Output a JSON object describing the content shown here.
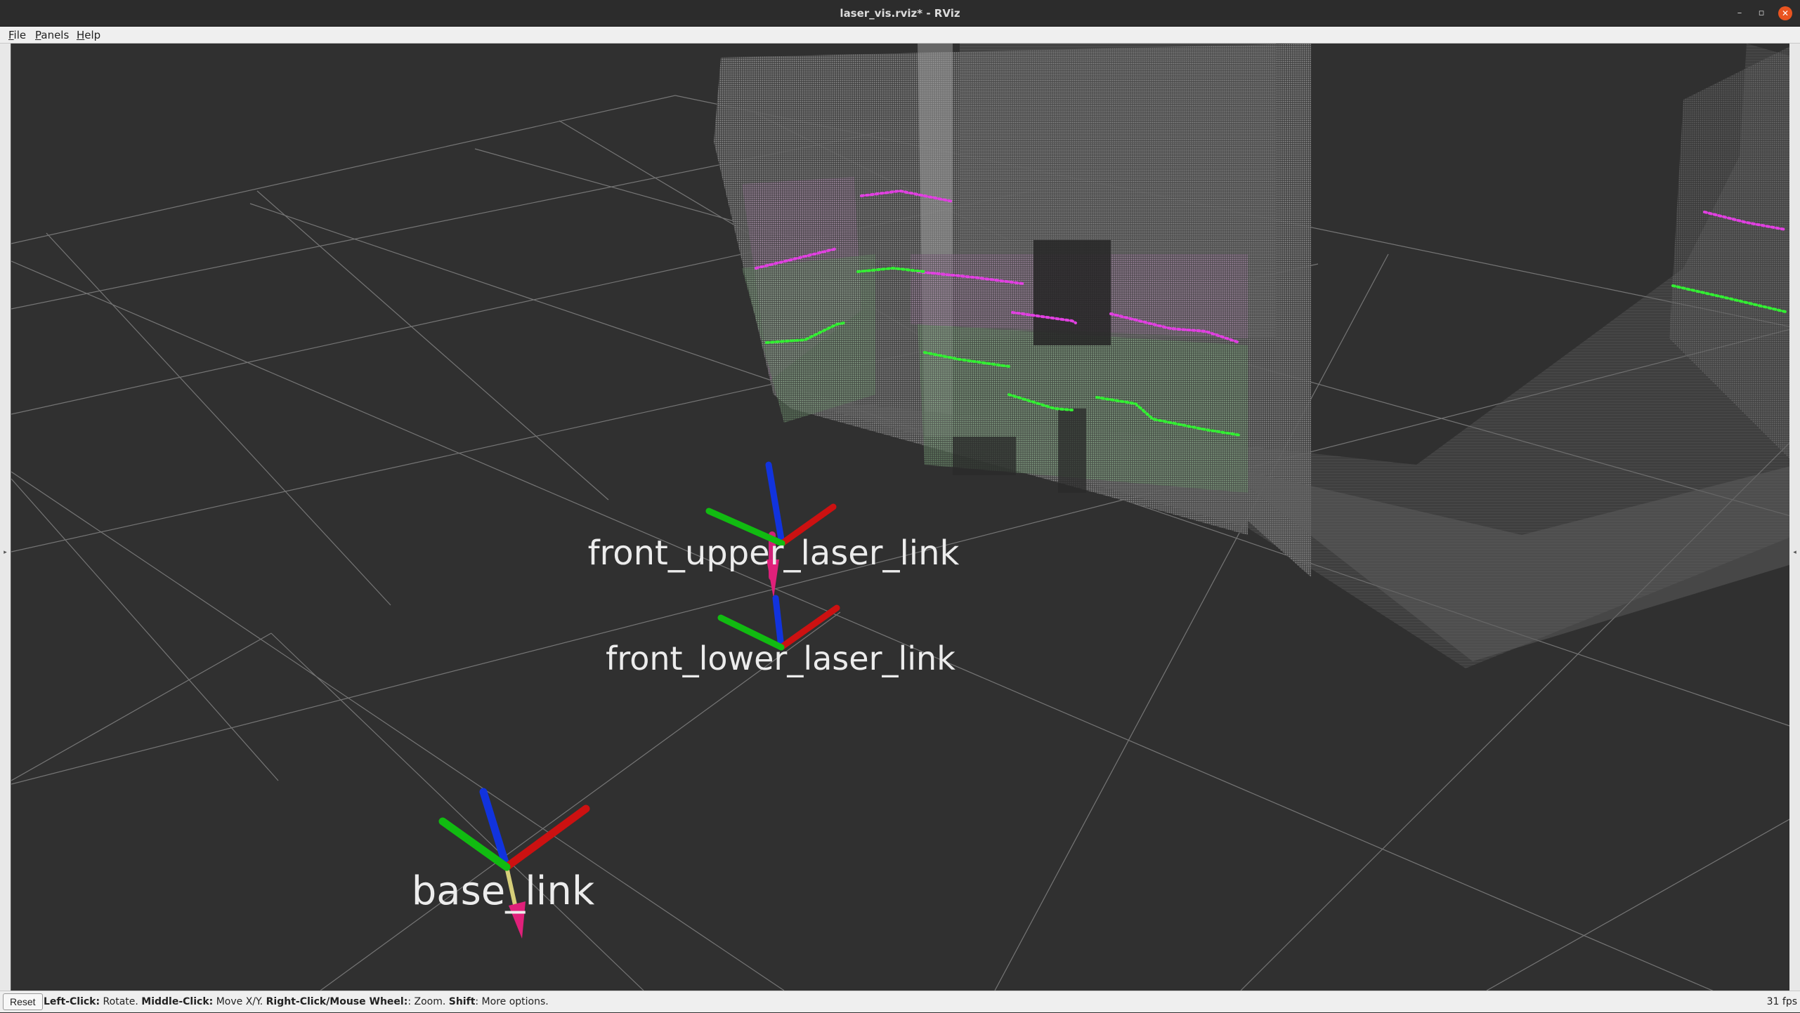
{
  "window": {
    "title": "laser_vis.rviz* - RViz",
    "minimize_icon": "minimize-icon",
    "maximize_icon": "maximize-icon",
    "close_icon": "close-icon",
    "minimize_glyph": "–",
    "maximize_glyph": "▫",
    "close_glyph": "✕"
  },
  "menu": {
    "file": {
      "mnemonic": "F",
      "rest": "ile"
    },
    "panels": {
      "mnemonic": "P",
      "rest": "anels"
    },
    "help": {
      "mnemonic": "H",
      "rest": "elp"
    }
  },
  "scene": {
    "frames": [
      {
        "name": "front_upper_laser_link"
      },
      {
        "name": "front_lower_laser_link"
      },
      {
        "name": "base_link"
      }
    ],
    "colors": {
      "background": "#303030",
      "grid": "#a0a0a0",
      "point_cloud": "#9a9a9a",
      "upper_scan": "#e040e0",
      "lower_scan": "#33ee33",
      "axis_x": "#cc1111",
      "axis_y": "#11bb11",
      "axis_z": "#1133dd",
      "arrow": "#e0207a"
    }
  },
  "status": {
    "reset_label": "Reset",
    "hints": [
      {
        "key": "Left-Click:",
        "desc": " Rotate. "
      },
      {
        "key": "Middle-Click:",
        "desc": " Move X/Y. "
      },
      {
        "key": "Right-Click/Mouse Wheel:",
        "desc": ": Zoom. "
      },
      {
        "key": "Shift",
        "desc": ": More options."
      }
    ],
    "fps": "31 fps"
  }
}
